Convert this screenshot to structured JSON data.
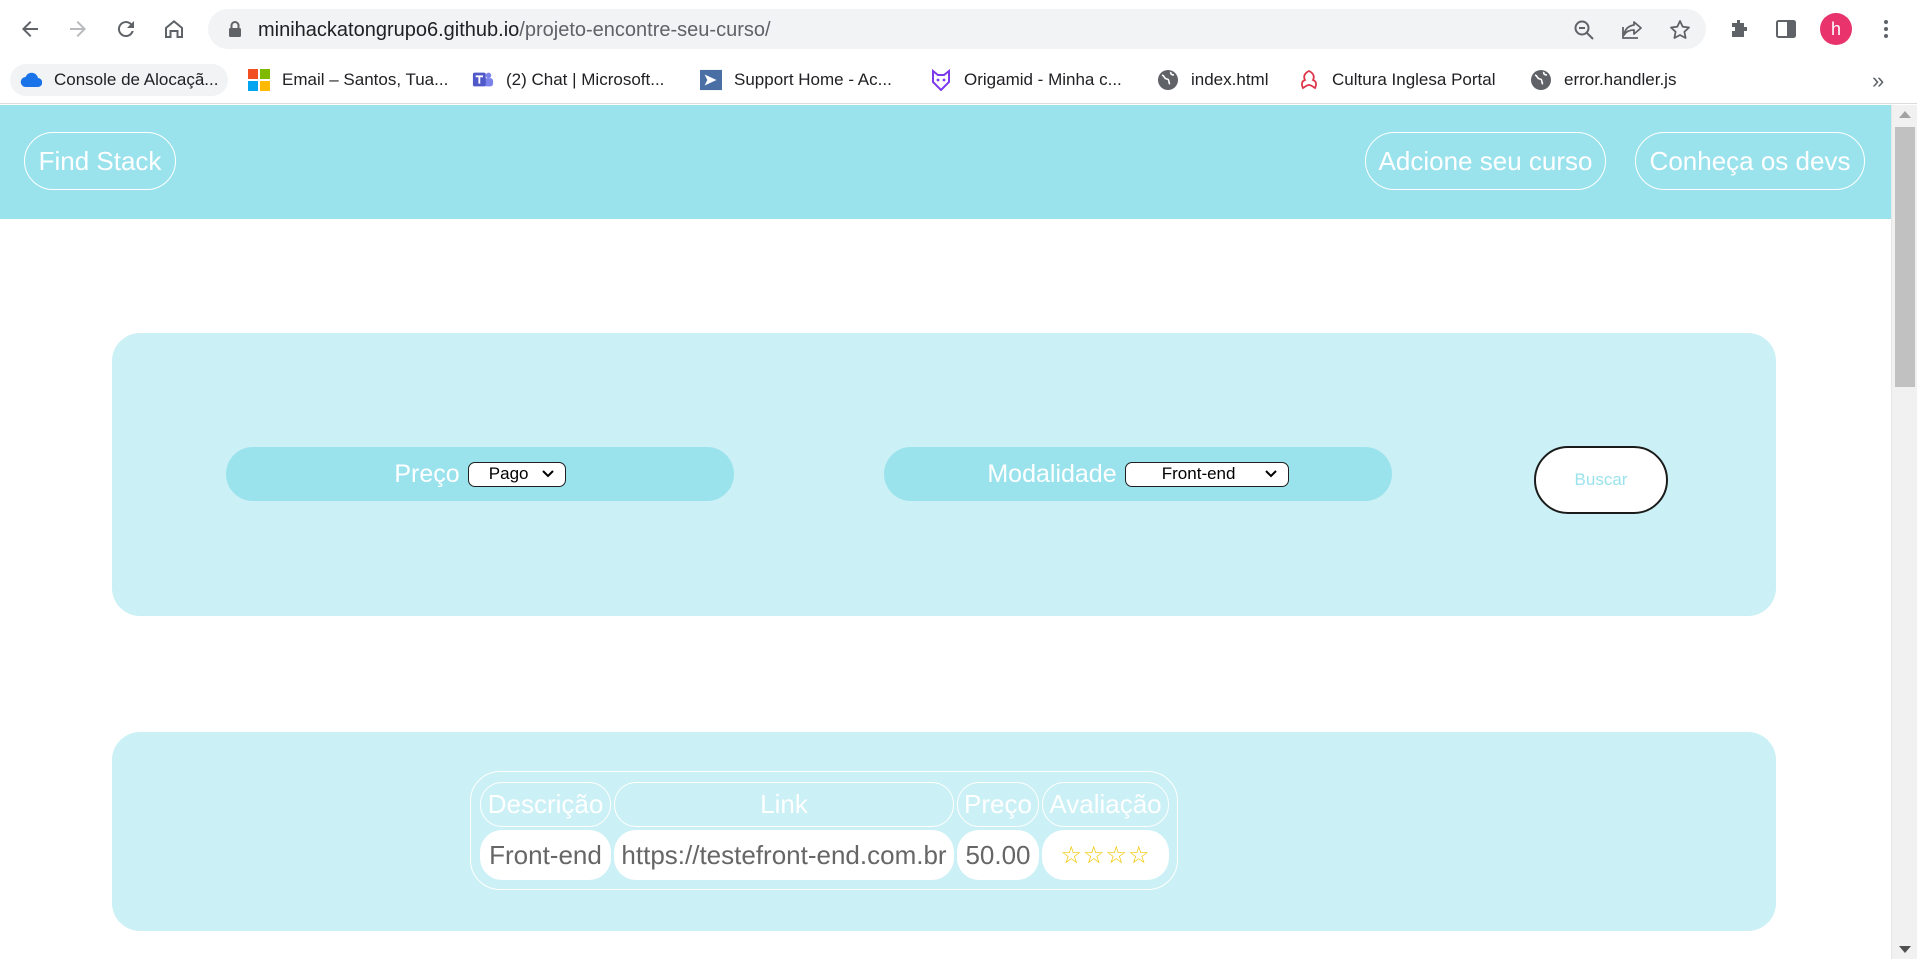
{
  "browser": {
    "url_host": "minihackatongrupo6.github.io",
    "url_path": "/projeto-encontre-seu-curso/",
    "avatar_letter": "h",
    "bookmarks": [
      {
        "label": "Console de Alocaçã..."
      },
      {
        "label": "Email – Santos, Tua..."
      },
      {
        "label": "(2) Chat | Microsoft..."
      },
      {
        "label": "Support Home - Ac..."
      },
      {
        "label": "Origamid - Minha c..."
      },
      {
        "label": "index.html"
      },
      {
        "label": "Cultura Inglesa Portal"
      },
      {
        "label": "error.handler.js"
      }
    ],
    "more_label": "»"
  },
  "header": {
    "brand": "Find Stack",
    "add_course": "Adcione seu curso",
    "meet_devs": "Conheça os devs",
    "color": "#9ae3ed"
  },
  "search": {
    "price_label": "Preço",
    "price_value": "Pago",
    "mode_label": "Modalidade",
    "mode_value": "Front-end",
    "submit_label": "Buscar",
    "panel_color": "#cbf0f5"
  },
  "results": {
    "headers": [
      "Descrição",
      "Link",
      "Preço",
      "Avaliação"
    ],
    "rows": [
      {
        "descricao": "Front-end",
        "link": "https://testefront-end.com.br",
        "preco": "50.00",
        "avaliacao": "☆☆☆☆"
      }
    ]
  }
}
